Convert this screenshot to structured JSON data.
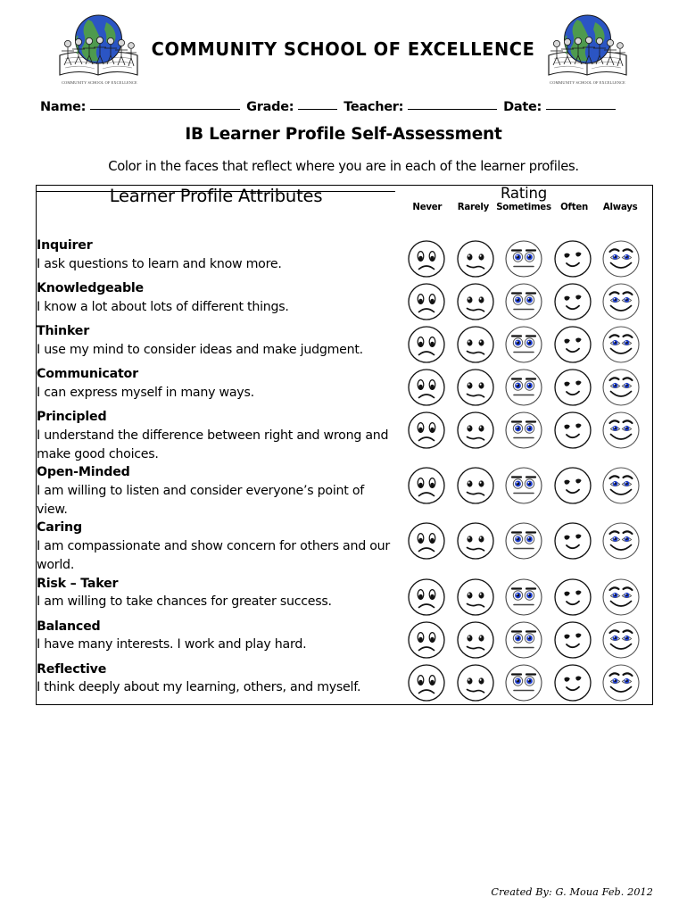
{
  "header": {
    "school_name": "COMMUNITY SCHOOL OF EXCELLENCE",
    "logo_caption_left": "COMMUNITY SCHOOL OF EXCELLENCE",
    "logo_caption_right": "COMMUNITY SCHOOL OF EXCELLENCE",
    "logo_colors": {
      "globe_ocean": "#2b55c4",
      "globe_land": "#4e9a4e",
      "book": "#ffffff",
      "outline": "#1a1a1a"
    }
  },
  "identity": {
    "name_label": "Name:",
    "name_value": "",
    "grade_label": "Grade:",
    "grade_value": "",
    "teacher_label": "Teacher:",
    "teacher_value": "",
    "date_label": "Date:",
    "date_value": ""
  },
  "document": {
    "title": "IB Learner Profile Self-Assessment",
    "instruction": "Color in the faces that reflect where you are in each of the learner profiles."
  },
  "table": {
    "attributes_header": "Learner Profile Attributes",
    "rating_header": "Rating",
    "scale": [
      "Never",
      "Rarely",
      "Sometimes",
      "Often",
      "Always"
    ],
    "rows": [
      {
        "title": "Inquirer",
        "description": "I ask questions to learn and know more."
      },
      {
        "title": "Knowledgeable",
        "description": "I know a lot about lots of different things."
      },
      {
        "title": "Thinker",
        "description": "I use my mind to consider ideas and make judgment."
      },
      {
        "title": "Communicator",
        "description": "I can express myself in many ways."
      },
      {
        "title": "Principled",
        "description": "I understand the difference between right and wrong and make good choices."
      },
      {
        "title": "Open-Minded",
        "description": "I am willing to listen and consider everyone’s point of view."
      },
      {
        "title": "Caring",
        "description": "I am compassionate and show concern for others and our world."
      },
      {
        "title": "Risk – Taker",
        "description": "I am willing to take chances for greater success."
      },
      {
        "title": "Balanced",
        "description": "I have many interests. I work and play hard."
      },
      {
        "title": "Reflective",
        "description": "I think deeply about my learning, others, and myself."
      }
    ]
  },
  "faces": {
    "items": [
      {
        "name": "face-never",
        "scale": "Never",
        "expression": "sad",
        "eye_color": "#000000"
      },
      {
        "name": "face-rarely",
        "scale": "Rarely",
        "expression": "slightly-sad",
        "eye_color": "#000000"
      },
      {
        "name": "face-sometimes",
        "scale": "Sometimes",
        "expression": "neutral",
        "eye_color": "#1f3fd0"
      },
      {
        "name": "face-often",
        "scale": "Often",
        "expression": "smile",
        "eye_color": "#000000"
      },
      {
        "name": "face-always",
        "scale": "Always",
        "expression": "big-smile",
        "eye_color": "#1f3fd0"
      }
    ]
  },
  "footer": {
    "credit": "Created By: G. Moua Feb. 2012"
  }
}
